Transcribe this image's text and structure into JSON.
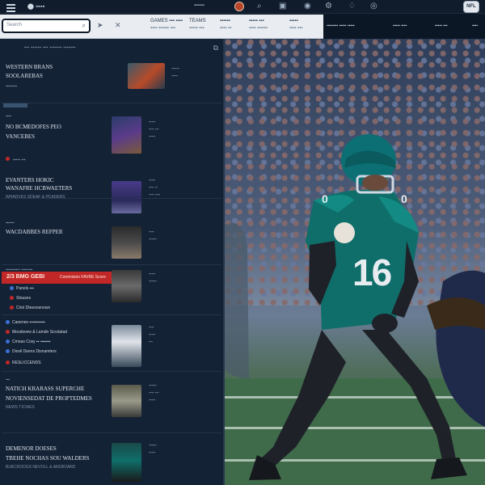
{
  "topbar": {
    "brand": "⬤ ▪▪▪▪",
    "link": "▪▪▪▪▪▪",
    "icons": [
      "search-icon",
      "user-icon",
      "stats-icon",
      "gear-icon",
      "bell-icon",
      "chat-icon"
    ],
    "logo_label": "NFL"
  },
  "search": {
    "placeholder": "Search",
    "icon": "magnifier-icon"
  },
  "subnav": {
    "items": [
      {
        "l1": "GAMES  ▪▪▪  ▪▪▪▪",
        "l2": "▪▪▪▪ ▪▪▪▪▪▪ ▪▪▪"
      },
      {
        "l1": "TEAMS",
        "l2": "▪▪▪▪▪ ▪▪▪"
      },
      {
        "l1": "▪▪▪▪▪▪",
        "l2": "▪▪▪▪ ▪▪"
      },
      {
        "l1": "▪▪▪▪▪  ▪▪▪",
        "l2": "▪▪▪▪ ▪▪▪▪▪▪"
      },
      {
        "l1": "▪▪▪▪▪",
        "l2": "▪▪▪▪ ▪▪▪"
      }
    ],
    "dark_items": [
      "▪▪▪▪▪▪▪▪ ▪▪▪▪▪ ▪▪▪▪▪",
      "▪▪▪▪▪ ▪▪▪▪",
      "▪▪▪▪▪ ▪▪▪",
      "▪▪▪▪"
    ]
  },
  "sidebar": {
    "header": "▪▪▪ ▪▪▪▪▪▪ ▪▪▪ ▪▪▪▪▪▪▪ ▪▪▪▪▪▪▪",
    "rows": [
      {
        "title1": "WESTERN BRANS",
        "title2": "SOOLAREBAS",
        "meta": "▪▪▪▪▪▪▪▪",
        "side": "▪▪▪▪▪▪\n▪▪▪▪▪"
      },
      {
        "title1": "NO BCMEDOFES PEO",
        "title2": "VANCEBES",
        "meta": "▪▪▪▪▪ ▪▪▪",
        "side": "▪▪▪▪▪\n▪▪▪▪ ▪▪▪\n▪▪▪▪▪"
      },
      {
        "title1": "EVANTERS HOKIC",
        "title2": "WANAFRE HCBWAETERS",
        "meta": "WHADVES SDEAF & PCADERS",
        "side": "▪▪▪▪▪\n▪▪▪▪ ▪▪\n▪▪▪▪ ▪▪▪▪"
      },
      {
        "title1": "WACDABBES REFPER",
        "title2": "",
        "meta": "▪▪▪▪▪▪",
        "side": "▪▪▪▪\n▪▪▪▪▪▪"
      },
      {
        "title1": "",
        "title2": "",
        "meta": "▪▪▪▪▪▪▪▪▪▪ ▪▪▪▪▪▪▪▪",
        "side": "▪▪▪▪▪\n▪▪▪▪▪▪"
      },
      {
        "title1": "",
        "title2": "",
        "meta": "",
        "side": "▪▪▪▪\n▪▪▪▪▪\n▪▪▪"
      },
      {
        "title1": "NATICH KRARASS SUPERCHE",
        "title2": "NOVIENSEDAT DE PROPTEDMES",
        "meta": "NEWS TICWES",
        "side": "▪▪▪▪▪▪\n▪▪▪▪ ▪▪▪\n▪▪▪▪▪"
      },
      {
        "title1": "DEMENOR DOESES",
        "title2": "TBEHE NOCHAS SOU WALDERS",
        "meta": "BUECKDOGS NEVOLL & AKEBOARD",
        "side": "▪▪▪▪▪▪\n▪▪▪▪▪"
      }
    ],
    "breaking": {
      "label": "2/3 BMG GEBI",
      "sub": "Commision FAVRE Score"
    },
    "list": [
      {
        "text": "Panels ▪▪▪",
        "color": "#3b6fd6"
      },
      {
        "text": "Stouses",
        "color": "#c33a3a"
      },
      {
        "text": "Clrol Dteesnenows",
        "color": "#c33a3a"
      },
      {
        "text": "Canenes ▪▪▪▪▪▪▪▪▪▪▪",
        "color": "#3b6fd6"
      },
      {
        "text": "Moodsvew & Lamdn Scrotatad",
        "color": "#c33a3a"
      },
      {
        "text": "Cmoas Cosy ▪▪ ▪▪▪▪▪▪▪",
        "color": "#3b6fd6"
      },
      {
        "text": "Diovil Deens Disnamters",
        "color": "#3b6fd6"
      },
      {
        "text": "RESLICCENDS",
        "color": "#c33a3a"
      }
    ]
  },
  "hero": {
    "jersey_number": "16",
    "jersey_color": "#0f6e6a",
    "helmet_color": "#0b6f74",
    "pants_color": "#1e2228"
  }
}
